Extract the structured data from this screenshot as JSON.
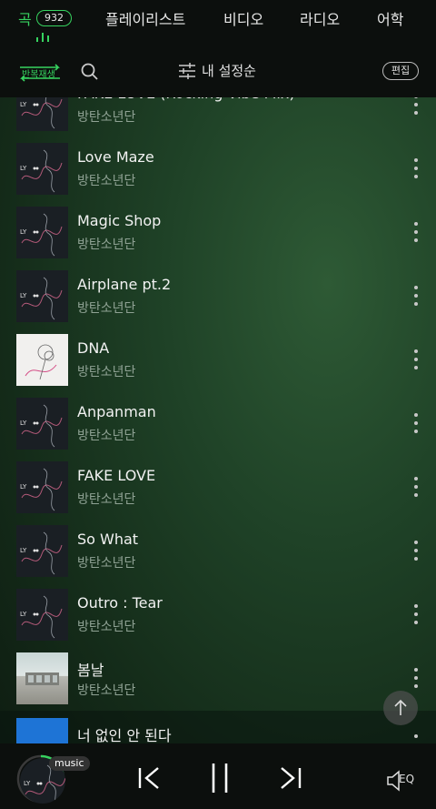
{
  "tabs": {
    "songs": "곡",
    "song_count": "932",
    "playlist": "플레이리스트",
    "video": "비디오",
    "radio": "라디오",
    "language": "어학"
  },
  "toolbar": {
    "repeat_label": "반복재생",
    "sort_label": "내 설정순",
    "edit_label": "편집"
  },
  "songs": [
    {
      "title": "FAKE LOVE (Rocking Vibe Mix)",
      "artist": "방탄소년단",
      "art": "lys-her"
    },
    {
      "title": "Love Maze",
      "artist": "방탄소년단",
      "art": "lys-tear"
    },
    {
      "title": "Magic Shop",
      "artist": "방탄소년단",
      "art": "lys-tear"
    },
    {
      "title": "Airplane pt.2",
      "artist": "방탄소년단",
      "art": "lys-tear"
    },
    {
      "title": "DNA",
      "artist": "방탄소년단",
      "art": "lys-her"
    },
    {
      "title": "Anpanman",
      "artist": "방탄소년단",
      "art": "lys-tear"
    },
    {
      "title": "FAKE LOVE",
      "artist": "방탄소년단",
      "art": "lys-tear"
    },
    {
      "title": "So What",
      "artist": "방탄소년단",
      "art": "lys-tear"
    },
    {
      "title": "Outro : Tear",
      "artist": "방탄소년단",
      "art": "lys-tear"
    },
    {
      "title": "봄날",
      "artist": "방탄소년단",
      "art": "you-never-walk-alone"
    },
    {
      "title": "너 없인 안 된다",
      "artist": "",
      "art": "blue"
    }
  ],
  "player": {
    "badge": "music",
    "eq_label": "EQ"
  },
  "colors": {
    "accent": "#36d35f",
    "header_bg": "#0c0f0d"
  }
}
